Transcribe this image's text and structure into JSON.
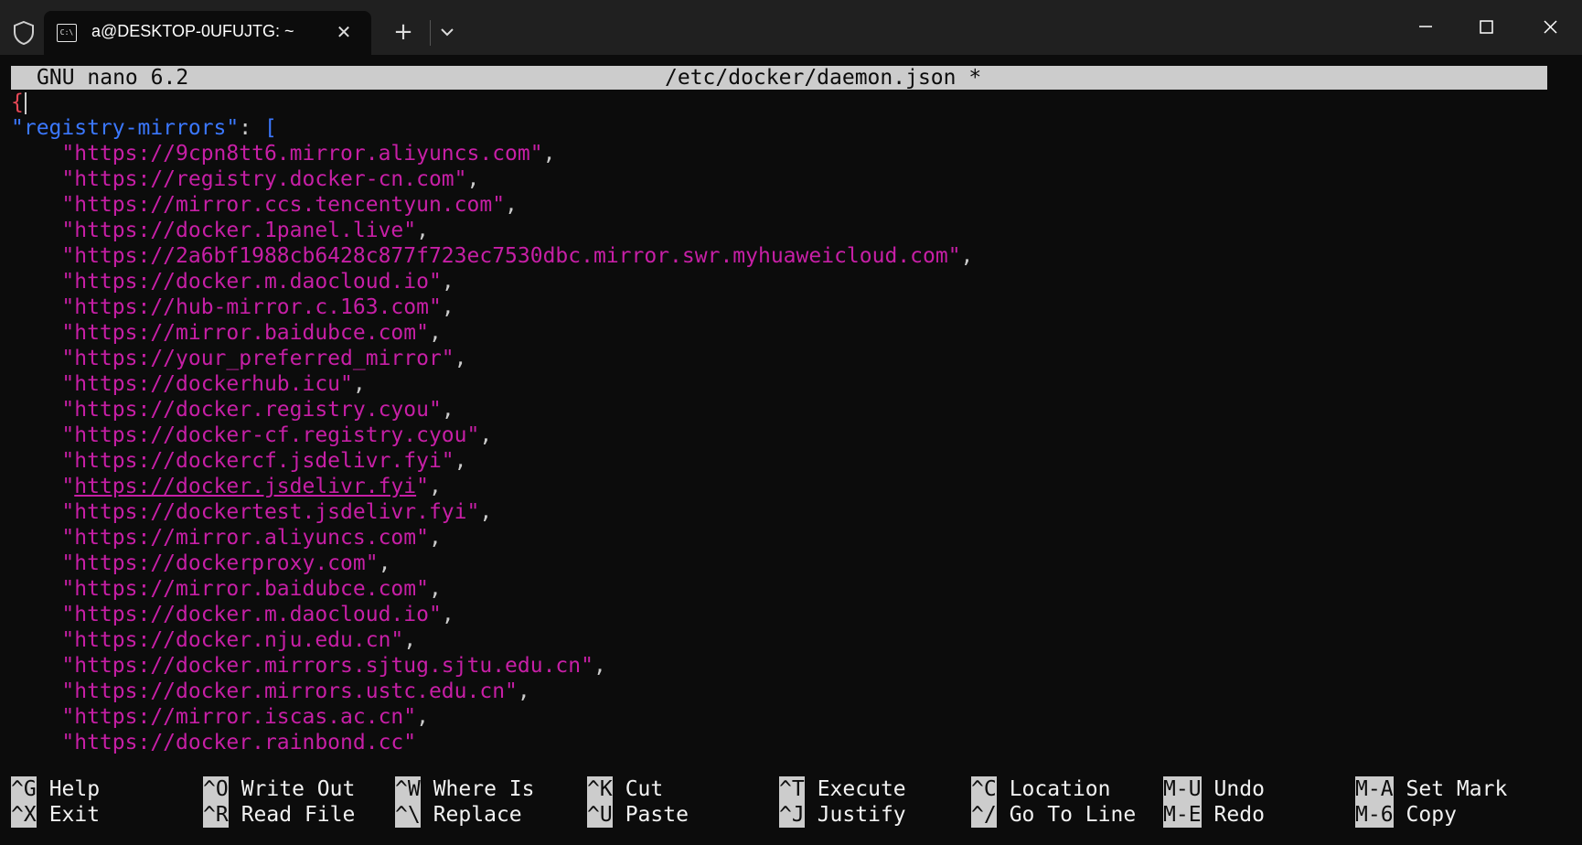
{
  "window": {
    "tab_title": "a@DESKTOP-0UFUJTG: ~",
    "tab_icon_text": "C:\\"
  },
  "nano": {
    "version": "GNU nano 6.2",
    "filename": "/etc/docker/daemon.json *"
  },
  "file": {
    "open_brace": "{",
    "key": "\"registry-mirrors\"",
    "colon": ": ",
    "open_bracket": "[",
    "mirrors": [
      "\"https://9cpn8tt6.mirror.aliyuncs.com\"",
      "\"https://registry.docker-cn.com\"",
      "\"https://mirror.ccs.tencentyun.com\"",
      "\"https://docker.1panel.live\"",
      "\"https://2a6bf1988cb6428c877f723ec7530dbc.mirror.swr.myhuaweicloud.com\"",
      "\"https://docker.m.daocloud.io\"",
      "\"https://hub-mirror.c.163.com\"",
      "\"https://mirror.baidubce.com\"",
      "\"https://your_preferred_mirror\"",
      "\"https://dockerhub.icu\"",
      "\"https://docker.registry.cyou\"",
      "\"https://docker-cf.registry.cyou\"",
      "\"https://dockercf.jsdelivr.fyi\"",
      "\"https://docker.jsdelivr.fyi\"",
      "\"https://dockertest.jsdelivr.fyi\"",
      "\"https://mirror.aliyuncs.com\"",
      "\"https://dockerproxy.com\"",
      "\"https://mirror.baidubce.com\"",
      "\"https://docker.m.daocloud.io\"",
      "\"https://docker.nju.edu.cn\"",
      "\"https://docker.mirrors.sjtug.sjtu.edu.cn\"",
      "\"https://docker.mirrors.ustc.edu.cn\"",
      "\"https://mirror.iscas.ac.cn\"",
      "\"https://docker.rainbond.cc\""
    ],
    "underlined_mirror_index": 13
  },
  "shortcuts": [
    {
      "key": "^G",
      "label": "Help"
    },
    {
      "key": "^O",
      "label": "Write Out"
    },
    {
      "key": "^W",
      "label": "Where Is"
    },
    {
      "key": "^K",
      "label": "Cut"
    },
    {
      "key": "^T",
      "label": "Execute"
    },
    {
      "key": "^C",
      "label": "Location"
    },
    {
      "key": "M-U",
      "label": "Undo"
    },
    {
      "key": "M-A",
      "label": "Set Mark"
    },
    {
      "key": "^X",
      "label": "Exit"
    },
    {
      "key": "^R",
      "label": "Read File"
    },
    {
      "key": "^\\",
      "label": "Replace"
    },
    {
      "key": "^U",
      "label": "Paste"
    },
    {
      "key": "^J",
      "label": "Justify"
    },
    {
      "key": "^/",
      "label": "Go To Line"
    },
    {
      "key": "M-E",
      "label": "Redo"
    },
    {
      "key": "M-6",
      "label": "Copy"
    }
  ],
  "colors": {
    "terminal_bg": "#0c0c0c",
    "titlebar_bg": "#202020",
    "string": "#c71fa6",
    "key": "#3b78ff",
    "brace": "#e74856",
    "header_bg": "#cccccc"
  }
}
